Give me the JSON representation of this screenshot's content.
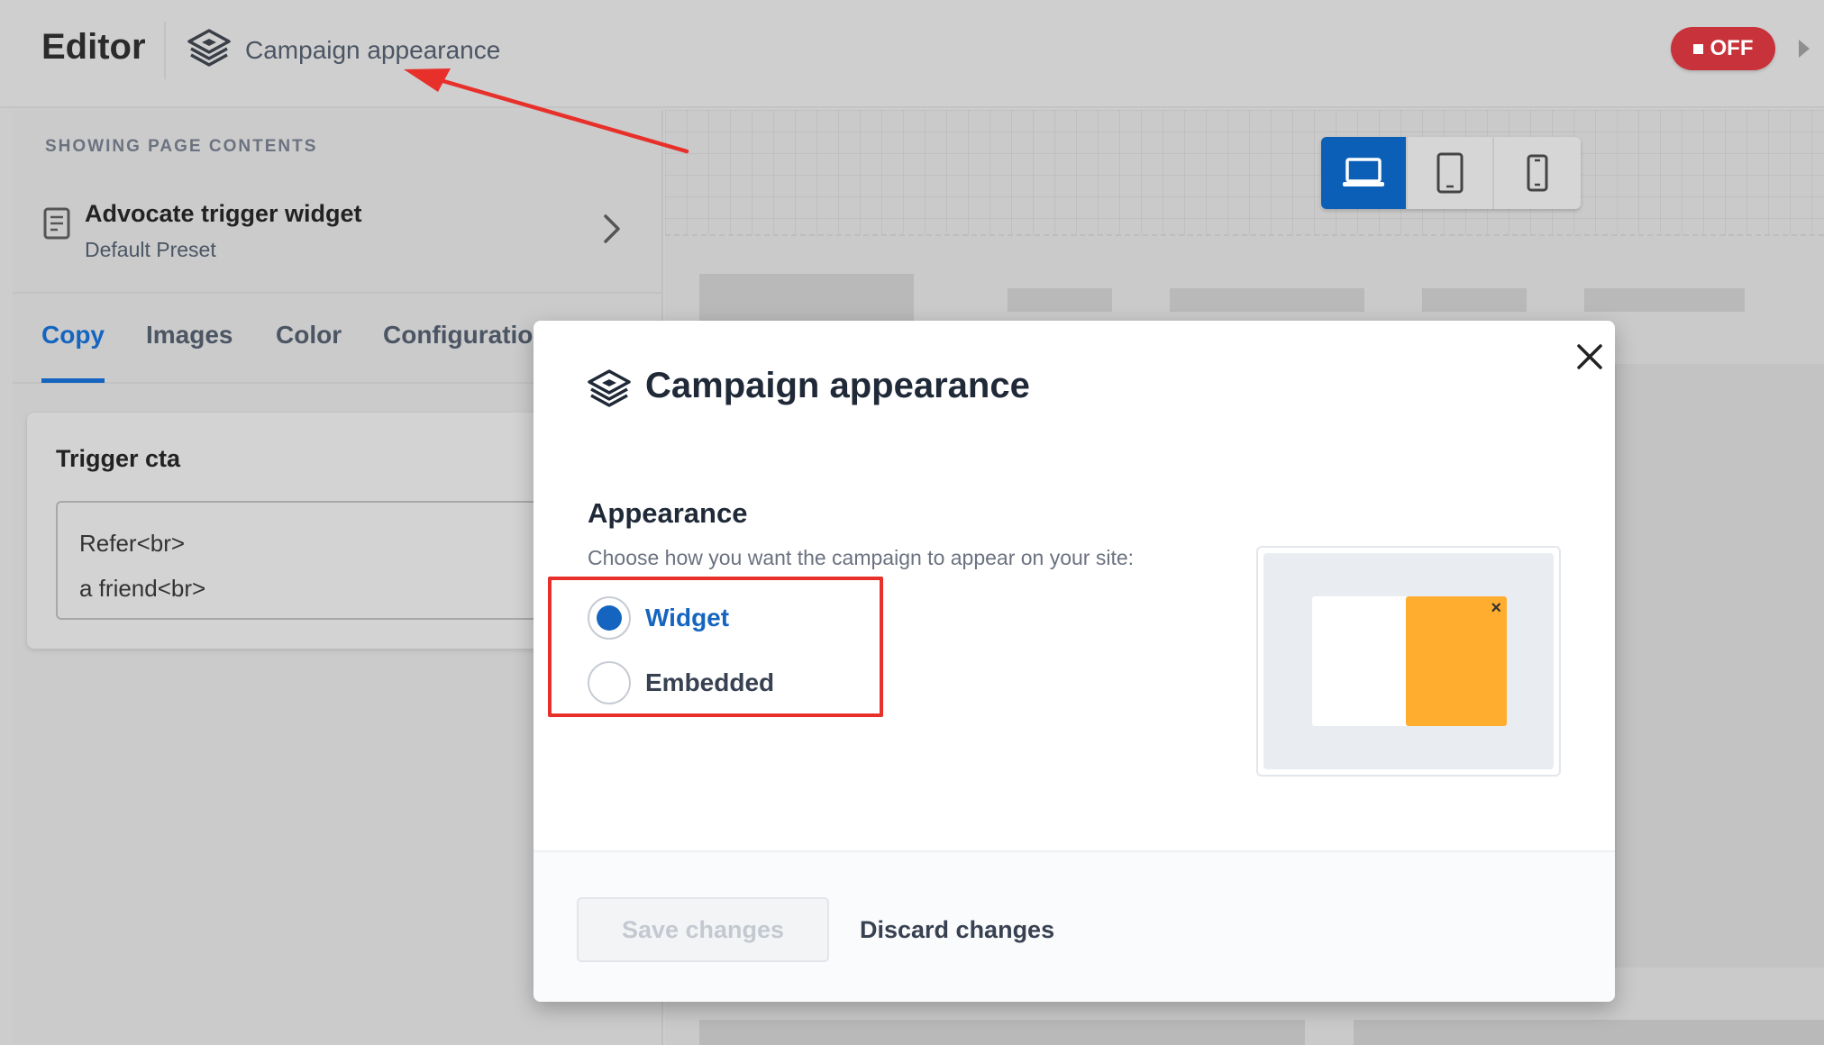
{
  "header": {
    "editor_title": "Editor",
    "subtitle": "Campaign appearance",
    "status_toggle": "OFF",
    "icons": {
      "layers": "layers-icon",
      "play": "play-icon"
    }
  },
  "left_panel": {
    "showing_label": "SHOWING PAGE CONTENTS",
    "page": {
      "title": "Advocate trigger widget",
      "subtitle": "Default Preset"
    },
    "tabs": [
      {
        "label": "Copy",
        "active": true
      },
      {
        "label": "Images",
        "active": false
      },
      {
        "label": "Color",
        "active": false
      },
      {
        "label": "Configuration",
        "active": false
      }
    ],
    "card": {
      "title": "Trigger cta",
      "lines": [
        "Refer<br>",
        "a friend<br>"
      ]
    }
  },
  "canvas": {
    "devices": [
      {
        "name": "desktop",
        "active": true
      },
      {
        "name": "tablet",
        "active": false
      },
      {
        "name": "mobile",
        "active": false
      }
    ]
  },
  "modal": {
    "title": "Campaign appearance",
    "section_title": "Appearance",
    "description": "Choose how you want the campaign to appear on your site:",
    "options": [
      {
        "label": "Widget",
        "selected": true
      },
      {
        "label": "Embedded",
        "selected": false
      }
    ],
    "preview_close": "×",
    "save_label": "Save changes",
    "discard_label": "Discard changes"
  },
  "colors": {
    "accent": "#1565c0",
    "off_red": "#c8323a",
    "annotation_red": "#e8302b",
    "preview_orange": "#ffad2f"
  }
}
